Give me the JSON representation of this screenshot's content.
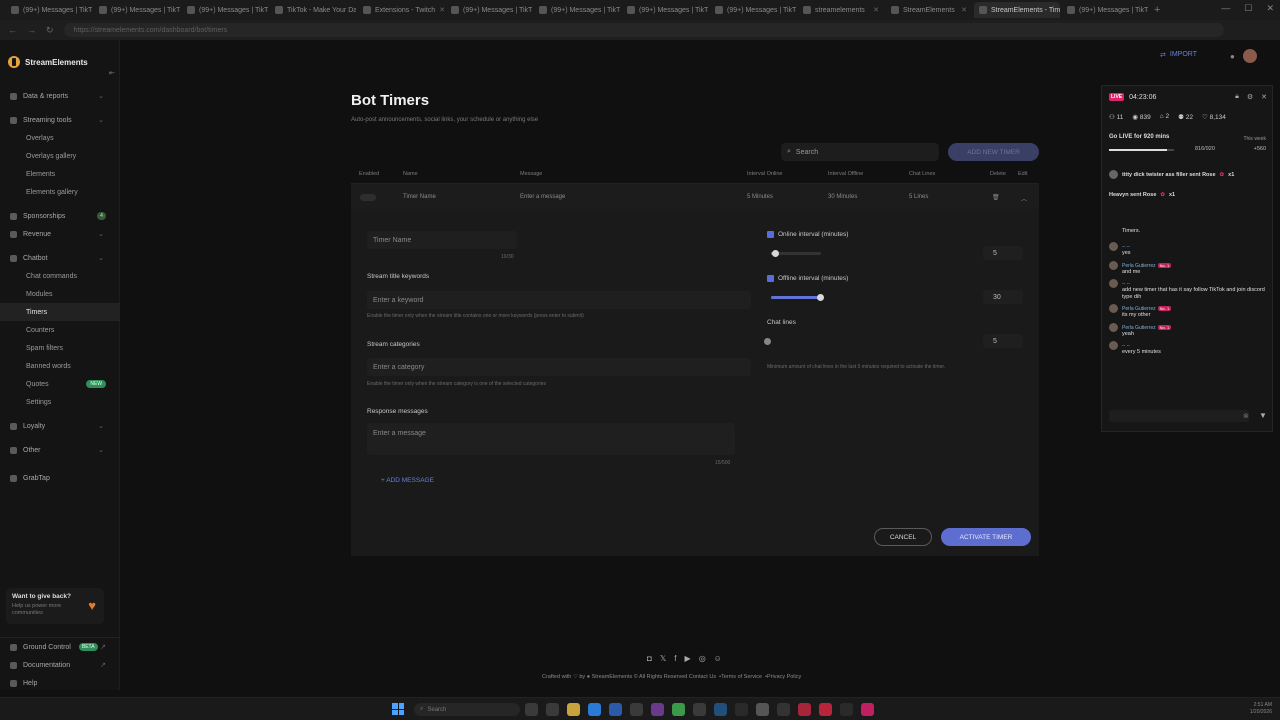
{
  "browser": {
    "tabs": [
      {
        "label": "(99+) Messages | TikTok",
        "active": false
      },
      {
        "label": "(99+) Messages | TikTok",
        "active": false
      },
      {
        "label": "(99+) Messages | TikTok",
        "active": false
      },
      {
        "label": "TikTok - Make Your Day",
        "active": false
      },
      {
        "label": "Extensions - Twitch",
        "active": false
      },
      {
        "label": "(99+) Messages | TikTok",
        "active": false
      },
      {
        "label": "(99+) Messages | TikTok",
        "active": false
      },
      {
        "label": "(99+) Messages | TikTok",
        "active": false
      },
      {
        "label": "(99+) Messages | TikTok",
        "active": false
      },
      {
        "label": "streamelements",
        "active": false
      },
      {
        "label": "StreamElements",
        "active": false
      },
      {
        "label": "StreamElements - Tim",
        "active": true
      },
      {
        "label": "(99+) Messages | TikTok",
        "active": false
      }
    ],
    "url": "https://streamelements.com/dashboard/bot/timers"
  },
  "sidebar": {
    "brand": "StreamElements",
    "items": [
      {
        "label": "Data & reports",
        "level": 0,
        "chevron": true
      },
      {
        "label": "Streaming tools",
        "level": 0,
        "chevron": true
      },
      {
        "label": "Overlays",
        "level": 1
      },
      {
        "label": "Overlays gallery",
        "level": 1
      },
      {
        "label": "Elements",
        "level": 1
      },
      {
        "label": "Elements gallery",
        "level": 1
      },
      {
        "label": "Sponsorships",
        "level": 0,
        "count": "4"
      },
      {
        "label": "Revenue",
        "level": 0,
        "chevron": true
      },
      {
        "label": "Chatbot",
        "level": 0,
        "chevron": true
      },
      {
        "label": "Chat commands",
        "level": 1
      },
      {
        "label": "Modules",
        "level": 1
      },
      {
        "label": "Timers",
        "level": 1,
        "active": true
      },
      {
        "label": "Counters",
        "level": 1
      },
      {
        "label": "Spam filters",
        "level": 1
      },
      {
        "label": "Banned words",
        "level": 1
      },
      {
        "label": "Quotes",
        "level": 1,
        "new": "NEW"
      },
      {
        "label": "Settings",
        "level": 1
      },
      {
        "label": "Loyalty",
        "level": 0,
        "chevron": true
      },
      {
        "label": "Other",
        "level": 0,
        "chevron": true
      },
      {
        "label": "GrabTap",
        "level": 0
      }
    ],
    "give_back": {
      "title": "Want to give back?",
      "subtitle": "Help us power more communities"
    },
    "bottom": [
      {
        "label": "Ground Control",
        "badge": "BETA"
      },
      {
        "label": "Documentation"
      },
      {
        "label": "Help"
      }
    ]
  },
  "header": {
    "import_label": "IMPORT"
  },
  "main": {
    "title": "Bot Timers",
    "subtitle": "Auto-post announcements, social links, your schedule or anything else",
    "search_placeholder": "Search",
    "add_timer_label": "ADD NEW TIMER",
    "columns": {
      "enabled": "Enabled",
      "name": "Name",
      "message": "Message",
      "interval_online": "Interval Online",
      "interval_offline": "Interval Offline",
      "chat_lines": "Chat Lines",
      "delete": "Delete",
      "edit": "Edit"
    },
    "row": {
      "name": "Timer Name",
      "message": "Enter a message",
      "interval_online": "5 Minutes",
      "interval_offline": "30 Minutes",
      "chat_lines": "5 Lines"
    },
    "form": {
      "timer_name_placeholder": "Timer Name",
      "timer_name_counter": "10/30",
      "keywords_label": "Stream title keywords",
      "keywords_placeholder": "Enter a keyword",
      "keywords_hint": "Enable the timer only when the stream title contains one or more keywords (press enter to submit)",
      "categories_label": "Stream categories",
      "categories_placeholder": "Enter a category",
      "categories_hint": "Enable the timer only when the stream category is one of the selected categories",
      "response_label": "Response messages",
      "message_placeholder": "Enter a message",
      "message_counter": "15/500",
      "add_message_label": "+ ADD MESSAGE",
      "online_label": "Online interval (minutes)",
      "online_value": "5",
      "online_fraction": 0.08,
      "offline_label": "Offline interval (minutes)",
      "offline_value": "30",
      "offline_fraction": 0.98,
      "chat_lines_label": "Chat lines",
      "chat_lines_value": "5",
      "chat_lines_fraction": 0.0,
      "chat_lines_hint": "Minimum amount of chat lines in the last 5 minutes required to activate the timer.",
      "cancel_label": "CANCEL",
      "activate_label": "ACTIVATE TIMER"
    }
  },
  "footer": {
    "crafted": "Crafted with",
    "by": "by",
    "brand": "StreamElements",
    "rights": "© All Rights Reserved",
    "contact": "Contact Us",
    "terms": "Terms of Service",
    "privacy": "Privacy Policy"
  },
  "chat_overlay": {
    "live_label": "LIVE",
    "uptime": "04:23:06",
    "stats": [
      "11",
      "839",
      "2",
      "22",
      "8,134"
    ],
    "goal_title": "Go LIVE for 920 mins",
    "goal_period": "This week",
    "goal_progress": "816/920",
    "goal_fraction": 0.887,
    "goal_right": "+560",
    "alerts": [
      {
        "text": "titty dick twister ass filler sent Rose",
        "count": "x1"
      },
      {
        "text": "Heavyn sent Rose",
        "count": "x1"
      }
    ],
    "messages": [
      {
        "name": "",
        "text": "Timers."
      },
      {
        "name": "-- --",
        "text": "yes"
      },
      {
        "name": "Perla Gutierrez",
        "badge": "No. 1",
        "text": "and me"
      },
      {
        "name": "-- --",
        "text": "add new timer that has it say follow TikTok and join discord type dih"
      },
      {
        "name": "Perla Gutierrez",
        "badge": "No. 1",
        "text": "its my other"
      },
      {
        "name": "Perla Gutierrez",
        "badge": "No. 1",
        "text": "yeah"
      },
      {
        "name": "-- --",
        "text": "every 5 minutes"
      }
    ]
  },
  "taskbar": {
    "search_placeholder": "Search",
    "time": "2:51 AM",
    "date": "1/20/2026"
  }
}
